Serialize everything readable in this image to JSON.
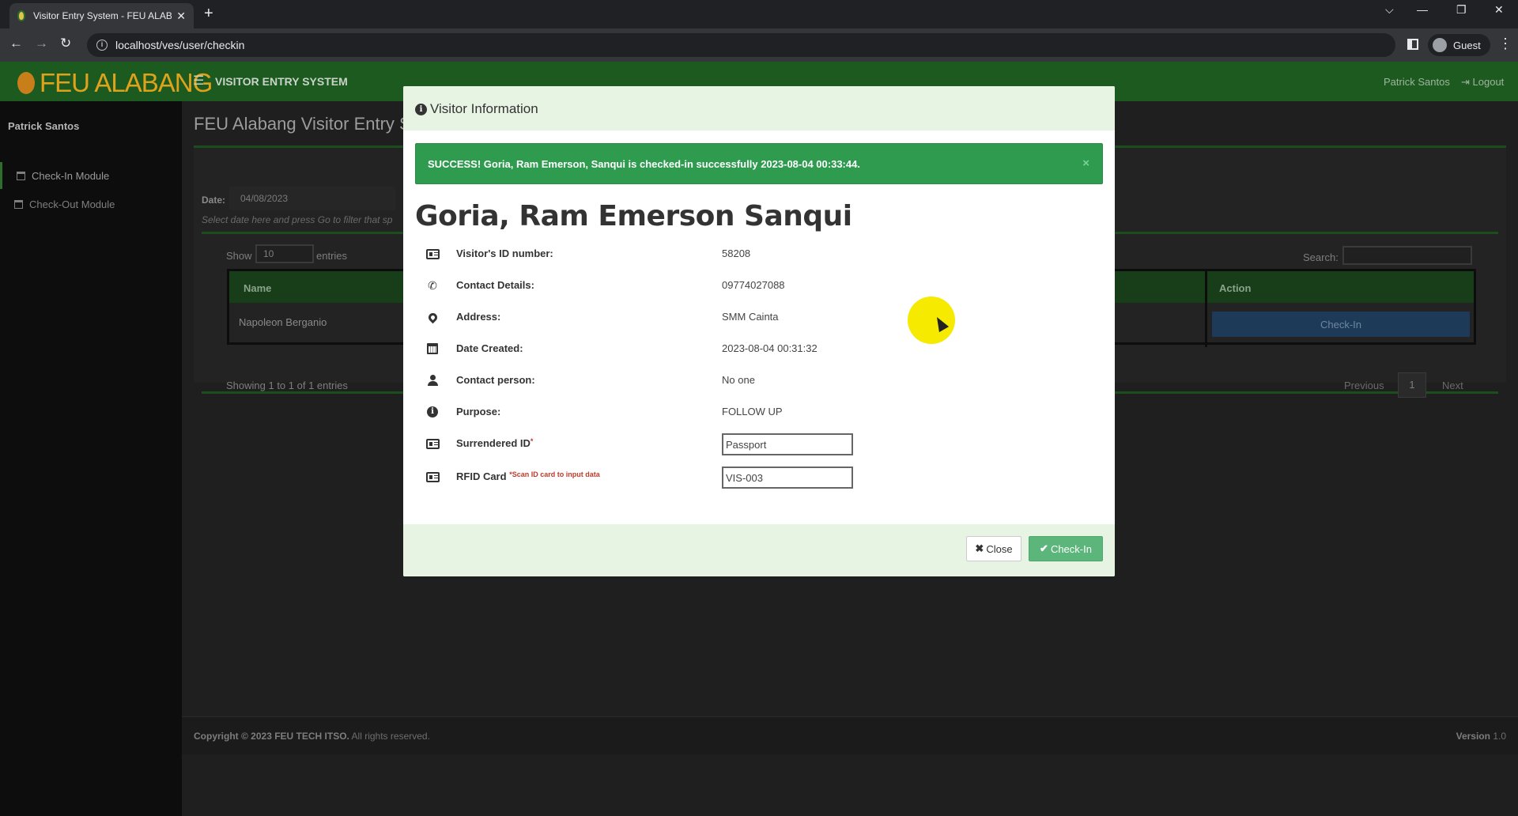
{
  "browser": {
    "tab_title": "Visitor Entry System - FEU ALABA",
    "tab_close": "✕",
    "new_tab": "+",
    "url": "localhost/ves/user/checkin",
    "profile_label": "Guest",
    "window_controls": {
      "tabsearch": "⌵",
      "minimize": "—",
      "restore": "❐",
      "close": "✕"
    }
  },
  "app": {
    "brand": "FEU ALABANG",
    "system_name": "VISITOR ENTRY SYSTEM",
    "header_user": "Patrick Santos",
    "logout_label": "Logout"
  },
  "sidebar": {
    "user": "Patrick Santos",
    "items": [
      {
        "label": "Check-In Module",
        "active": true
      },
      {
        "label": "Check-Out Module",
        "active": false
      }
    ]
  },
  "main": {
    "page_title": "FEU Alabang Visitor Entry S",
    "date_label": "Date:",
    "date_value": "04/08/2023",
    "date_hint": "Select date here and press Go to filter that sp",
    "show_label": "Show",
    "show_value": "10",
    "entries_label": "entries",
    "search_label": "Search:",
    "table": {
      "columns": [
        "Name",
        "Action"
      ],
      "rows": [
        {
          "name": "Napoleon Berganio",
          "action": "Check-In"
        }
      ]
    },
    "showing_text": "Showing 1 to 1 of 1 entries",
    "pagination": {
      "previous": "Previous",
      "page": "1",
      "next": "Next"
    }
  },
  "footer": {
    "copyright_bold": "Copyright © 2023 FEU TECH ITSO.",
    "copyright_rest": " All rights reserved.",
    "version_label": "Version",
    "version_value": "1.0"
  },
  "modal": {
    "title": "Visitor Information",
    "alert_text": "SUCCESS! Goria, Ram Emerson, Sanqui is checked-in successfully 2023-08-04 00:33:44.",
    "alert_close": "×",
    "visitor_name": "Goria, Ram Emerson Sanqui",
    "fields": [
      {
        "icon": "id-card-icon",
        "label": "Visitor's ID number:",
        "value": "58208"
      },
      {
        "icon": "phone-icon",
        "label": "Contact Details:",
        "value": "09774027088"
      },
      {
        "icon": "map-marker-icon",
        "label": "Address:",
        "value": "SMM Cainta"
      },
      {
        "icon": "calendar-icon",
        "label": "Date Created:",
        "value": "2023-08-04 00:31:32"
      },
      {
        "icon": "user-icon",
        "label": "Contact person:",
        "value": "No one"
      },
      {
        "icon": "info-circle-icon",
        "label": "Purpose:",
        "value": "FOLLOW UP"
      }
    ],
    "surrendered_id": {
      "label": "Surrendered ID",
      "required_mark": "*",
      "value": "Passport"
    },
    "rfid": {
      "label": "RFID Card",
      "note": "*Scan ID card to input data",
      "value": "VIS-003"
    },
    "close_button": "Close",
    "checkin_button": "Check-In"
  }
}
